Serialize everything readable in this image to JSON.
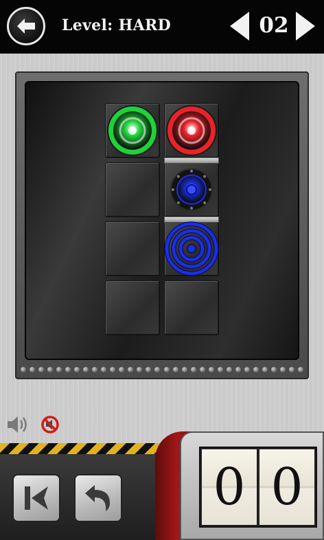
{
  "header": {
    "level_prefix": "Level:",
    "difficulty": "HARD",
    "level_number": "02"
  },
  "board": {
    "columns": 2,
    "rows": 4,
    "pieces": [
      {
        "col": 0,
        "row": 0,
        "color": "#1fd13a",
        "kind": "glowing-ring"
      },
      {
        "col": 1,
        "row": 0,
        "color": "#e8232a",
        "kind": "glowing-ring"
      },
      {
        "col": 1,
        "row": 1,
        "color": "#1c2fe0",
        "kind": "small-ball"
      },
      {
        "col": 1,
        "row": 2,
        "color": "#1c2fe0",
        "kind": "concentric-rings"
      }
    ],
    "links": [
      {
        "col": 1,
        "between_rows": [
          0,
          1
        ]
      },
      {
        "col": 1,
        "between_rows": [
          1,
          2
        ]
      }
    ]
  },
  "controls": {
    "sound_icon": "speaker-icon",
    "mute_icon": "no-sound-icon",
    "restart_icon": "restart-icon",
    "undo_icon": "undo-icon"
  },
  "counter": {
    "digits": [
      "0",
      "0"
    ]
  },
  "colors": {
    "hazard_yellow": "#e0b21f",
    "counter_red": "#a31717"
  }
}
